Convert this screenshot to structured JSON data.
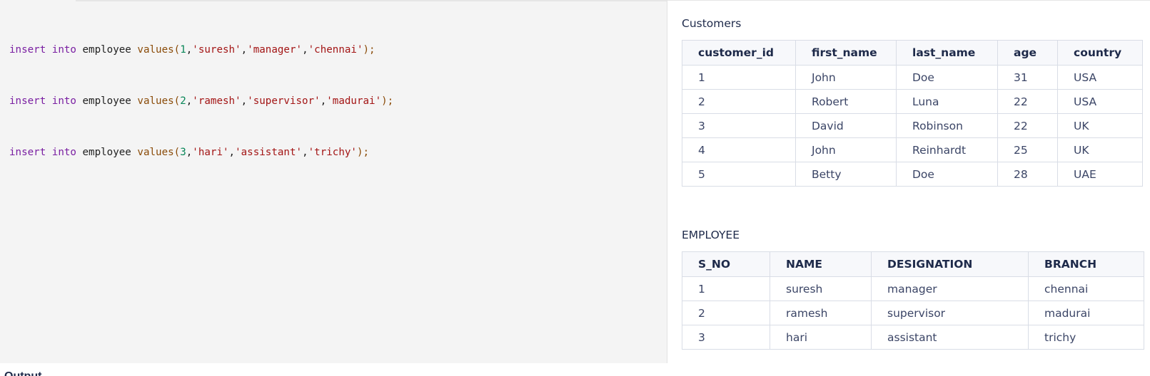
{
  "editor": {
    "lines": [
      {
        "kw1": "insert",
        "kw2": "into",
        "table": "employee",
        "fn": "values",
        "open": "(",
        "num": "1",
        "s1": "'suresh'",
        "s2": "'manager'",
        "s3": "'chennai'",
        "close": ");"
      },
      {
        "kw1": "insert",
        "kw2": "into",
        "table": "employee",
        "fn": "values",
        "open": "(",
        "num": "2",
        "s1": "'ramesh'",
        "s2": "'supervisor'",
        "s3": "'madurai'",
        "close": ");"
      },
      {
        "kw1": "insert",
        "kw2": "into",
        "table": "employee",
        "fn": "values",
        "open": "(",
        "num": "3",
        "s1": "'hari'",
        "s2": "'assistant'",
        "s3": "'trichy'",
        "close": ");"
      }
    ],
    "output_label": "Output"
  },
  "customers": {
    "title": "Customers",
    "columns": [
      "customer_id",
      "first_name",
      "last_name",
      "age",
      "country"
    ],
    "rows": [
      [
        "1",
        "John",
        "Doe",
        "31",
        "USA"
      ],
      [
        "2",
        "Robert",
        "Luna",
        "22",
        "USA"
      ],
      [
        "3",
        "David",
        "Robinson",
        "22",
        "UK"
      ],
      [
        "4",
        "John",
        "Reinhardt",
        "25",
        "UK"
      ],
      [
        "5",
        "Betty",
        "Doe",
        "28",
        "UAE"
      ]
    ]
  },
  "employee": {
    "title": "EMPLOYEE",
    "columns": [
      "S_NO",
      "NAME",
      "DESIGNATION",
      "BRANCH"
    ],
    "rows": [
      [
        "1",
        "suresh",
        "manager",
        "chennai"
      ],
      [
        "2",
        "ramesh",
        "supervisor",
        "madurai"
      ],
      [
        "3",
        "hari",
        "assistant",
        "trichy"
      ]
    ]
  }
}
